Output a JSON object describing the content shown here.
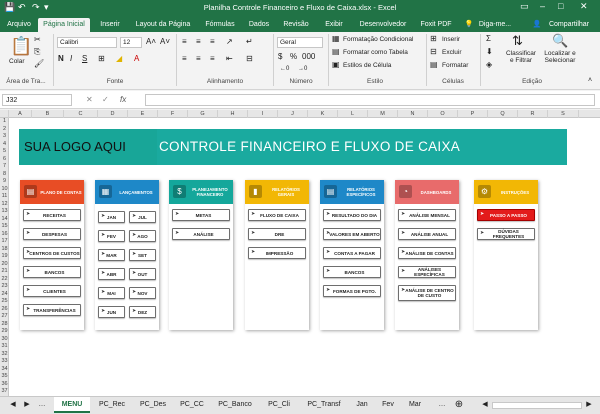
{
  "window": {
    "title": "Planilha Controle Financeiro e Fluxo de Caixa.xlsx - Excel"
  },
  "ribbon_tabs": [
    "Arquivo",
    "Página Inicial",
    "Inserir",
    "Layout da Página",
    "Fórmulas",
    "Dados",
    "Revisão",
    "Exibir",
    "Desenvolvedor",
    "Foxit PDF",
    "Diga-me..."
  ],
  "share_label": "Compartilhar",
  "ribbon": {
    "paste_label": "Colar",
    "clipboard_group": "Área de Tra...",
    "font_name": "Calibri",
    "font_size": "12",
    "font_group": "Fonte",
    "alignment_group": "Alinhamento",
    "number_format": "Geral",
    "number_group": "Número",
    "cond_format": "Formatação Condicional",
    "format_table": "Formatar como Tabela",
    "cell_styles": "Estilos de Célula",
    "styles_group": "Estilo",
    "insert_cells": "Inserir",
    "delete_cells": "Excluir",
    "format_cells": "Formatar",
    "cells_group": "Células",
    "sort_filter": "Classificar e Filtrar",
    "find_select": "Localizar e Selecionar",
    "editing_group": "Edição"
  },
  "formula_bar": {
    "name_box": "J32",
    "fx": "fx"
  },
  "columns": [
    "A",
    "B",
    "C",
    "D",
    "E",
    "F",
    "G",
    "H",
    "I",
    "J",
    "K",
    "L",
    "M",
    "N",
    "O",
    "P",
    "Q",
    "R",
    "S"
  ],
  "rows": [
    "1",
    "2",
    "3",
    "4",
    "5",
    "6",
    "7",
    "8",
    "9",
    "10",
    "11",
    "12",
    "13",
    "14",
    "15",
    "16",
    "17",
    "18",
    "19",
    "20",
    "21",
    "22",
    "23",
    "24",
    "25",
    "26",
    "27",
    "28",
    "29",
    "30",
    "31",
    "32",
    "33",
    "34",
    "35",
    "36",
    "37"
  ],
  "dashboard": {
    "logo_text": "SUA LOGO AQUI",
    "title": "CONTROLE FINANCEIRO E FLUXO DE CAIXA",
    "cards": [
      {
        "title": "PLANO DE CONTAS",
        "color": "#e84d25",
        "icon": "clipboard",
        "buttons": [
          "RECEITAS",
          "DESPESAS",
          "CENTROS DE CUSTOS",
          "BANCOS",
          "CLIENTES",
          "TRANSFERÊNCIAS"
        ]
      },
      {
        "title": "LANÇAMENTOS",
        "color": "#1e88c8",
        "icon": "calendar",
        "months_left": [
          "JAN",
          "FEV",
          "MAR",
          "ABR",
          "MAI",
          "JUN"
        ],
        "months_right": [
          "JUL",
          "AGO",
          "SET",
          "OUT",
          "NOV",
          "DEZ"
        ]
      },
      {
        "title": "PLANEJAMENTO FINANCEIRO",
        "color": "#14a79b",
        "icon": "money",
        "buttons": [
          "METAS",
          "ANÁLISE"
        ]
      },
      {
        "title": "RELATÓRIOS GERAIS",
        "color": "#f2b705",
        "icon": "bar-chart",
        "buttons": [
          "FLUXO DE CAIXA",
          "DRE",
          "IMPRESSÃO"
        ]
      },
      {
        "title": "RELATÓRIOS ESPECÍFICOS",
        "color": "#1e88c8",
        "icon": "document",
        "buttons": [
          "RESULTADO DO DIA",
          "VALORES EM ABERTO",
          "CONTAS A PAGAR",
          "BANCOS",
          "FORMAS DE PGTO."
        ]
      },
      {
        "title": "DASHBOARDS",
        "color": "#e86b6b",
        "icon": "dashboard",
        "buttons": [
          "ANÁLISE MENSAL",
          "ANÁLISE ANUAL",
          "ANÁLISE DE CONTAS",
          "ANÁLISES ESPECÍFICAS",
          "ANÁLISE DE CENTRO DE CUSTO"
        ]
      },
      {
        "title": "INSTRUÇÕES",
        "color": "#f2b705",
        "icon": "gear",
        "buttons": [
          "PASSO A PASSO",
          "DÚVIDAS FREQUENTES"
        ]
      }
    ]
  },
  "sheet_tabs": [
    "MENU",
    "PC_Rec",
    "PC_Des",
    "PC_CC",
    "PC_Banco",
    "PC_Cli",
    "PC_Transf",
    "Jan",
    "Fev",
    "Mar"
  ],
  "active_sheet": "MENU"
}
